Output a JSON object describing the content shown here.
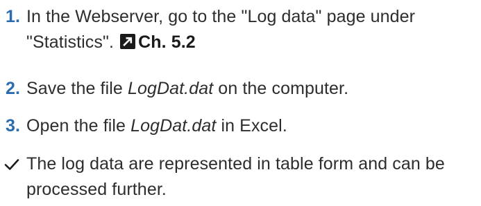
{
  "steps": [
    {
      "marker": "1.",
      "text_before": "In the Webserver, go to the \"Log data\" page under \"Statistics\".",
      "ref_label": "Ch. 5.2"
    },
    {
      "marker": "2.",
      "text_before": "Save the file ",
      "file": "LogDat.dat",
      "text_after": " on the computer."
    },
    {
      "marker": "3.",
      "text_before": "Open the file ",
      "file": "LogDat.dat",
      "text_after": " in Excel."
    }
  ],
  "result": {
    "icon": "checkmark-icon",
    "text": "The log data are represented in table form and can be processed further."
  },
  "colors": {
    "marker": "#2b6cb0",
    "text": "#2d2d2d",
    "icon": "#1a1a1a"
  },
  "ref_icon": "arrow-link-icon"
}
